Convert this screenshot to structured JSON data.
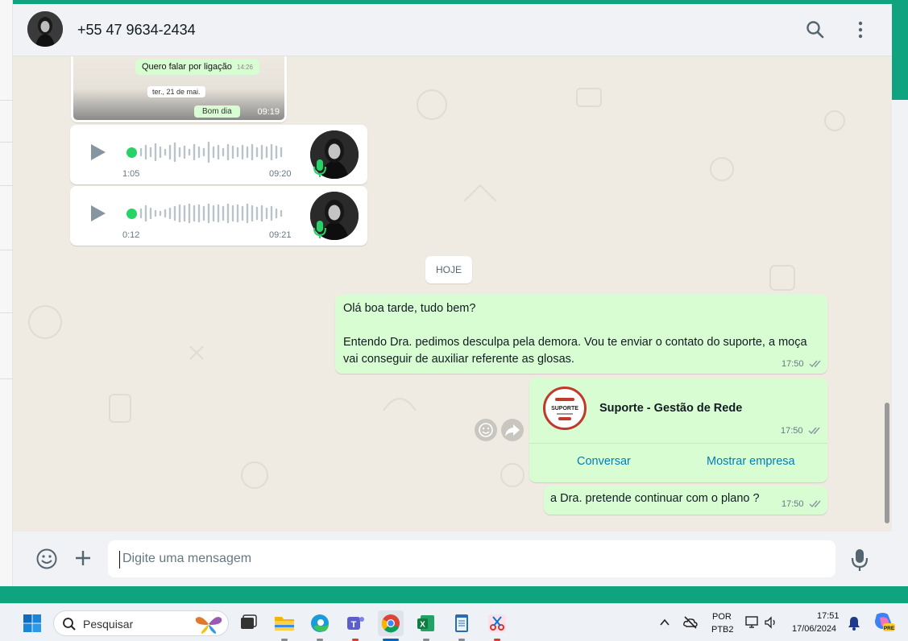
{
  "chat": {
    "contact_name": "+55 47 9634-2434",
    "input_placeholder": "Digite uma mensagem"
  },
  "image_message": {
    "inner_bubble_text": "Quero falar por ligação",
    "inner_bubble_time": "14:26",
    "inner_date": "ter., 21 de mai.",
    "inner_bubble2_text": "Bom dia",
    "time": "09:19"
  },
  "audio_messages": [
    {
      "duration": "1:05",
      "time": "09:20"
    },
    {
      "duration": "0:12",
      "time": "09:21"
    }
  ],
  "date_divider": "HOJE",
  "outgoing_text": {
    "lines": [
      "Olá boa tarde, tudo bem?",
      "",
      "Entendo Dra. pedimos desculpa pela demora. Vou te enviar o contato do suporte, a moça vai conseguir de auxiliar referente as glosas."
    ],
    "time": "17:50"
  },
  "contact_card": {
    "name": "Suporte - Gestão de Rede",
    "logo_text": "SUPORTE",
    "time": "17:50",
    "chat_label": "Conversar",
    "business_label": "Mostrar empresa"
  },
  "question_message": {
    "text": "a Dra. pretende continuar com o plano ?",
    "time": "17:50"
  },
  "taskbar": {
    "search_label": "Pesquisar",
    "lang_line1": "POR",
    "lang_line2": "PTB2",
    "time": "17:51",
    "date": "17/06/2024",
    "copilot_badge": "PRE"
  },
  "colors": {
    "accent_green": "#25d366",
    "outgoing_bubble": "#d9fdd3",
    "link_blue": "#027eb5",
    "window_frame": "#0fa37f"
  },
  "icons": [
    "search-icon",
    "menu-dots-icon",
    "play-icon",
    "mic-icon",
    "emoji-icon",
    "plus-icon",
    "forward-icon",
    "double-check-icon",
    "windows-start-icon"
  ]
}
